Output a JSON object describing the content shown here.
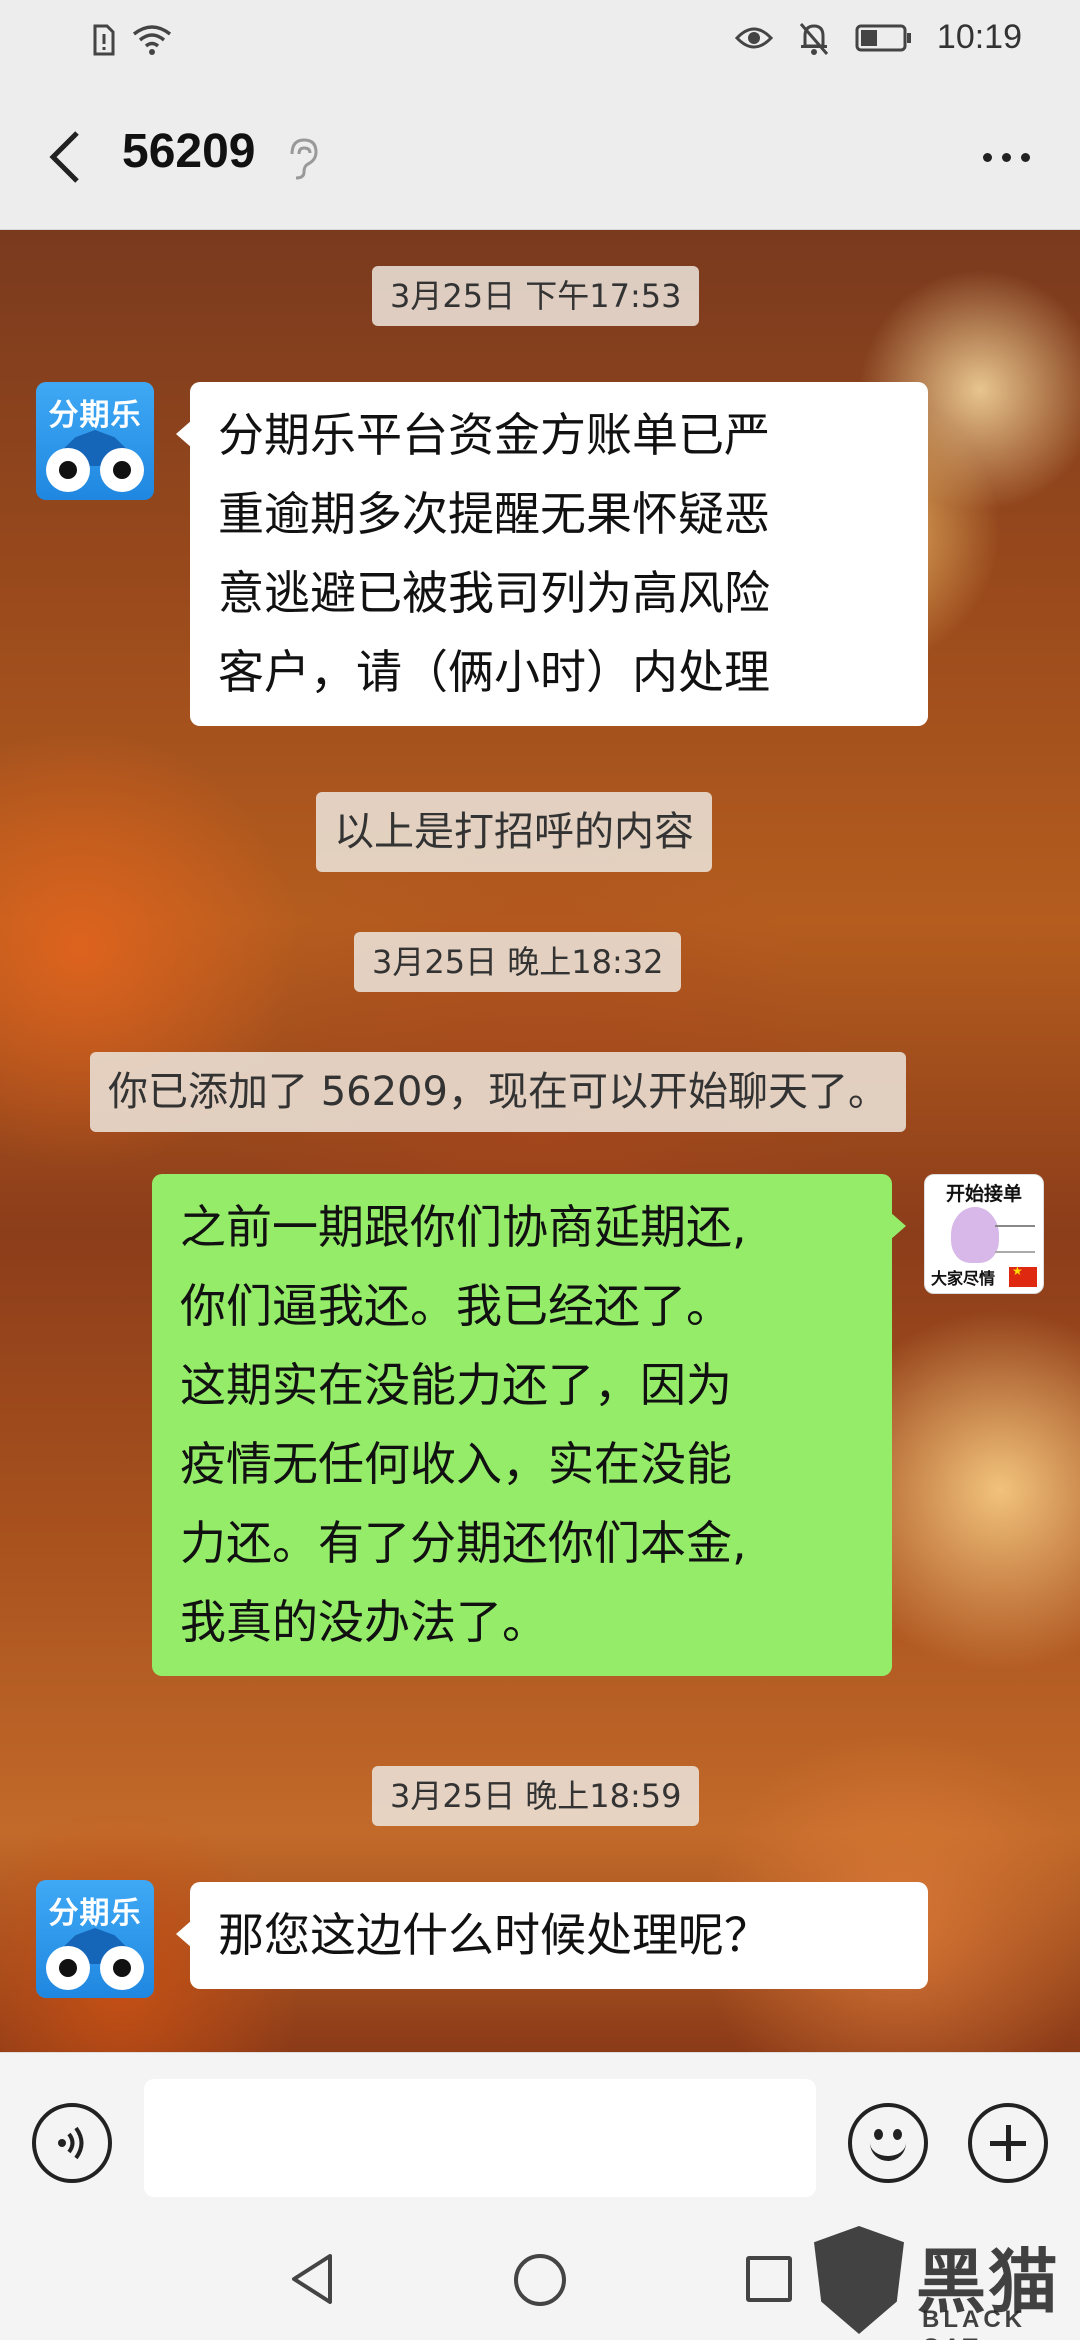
{
  "status_bar": {
    "time": "10:19"
  },
  "header": {
    "title": "56209"
  },
  "messages": {
    "ts1": "3月25日 下午17:53",
    "in1": {
      "avatar_text": "分期乐",
      "lines": [
        "分期乐平台资金方账单已严",
        "重逾期多次提醒无果怀疑恶",
        "意逃避已被我司列为高风险",
        "客户，请（俩小时）内处理"
      ]
    },
    "sys1": "以上是打招呼的内容",
    "ts2": "3月25日 晚上18:32",
    "sys2": "你已添加了 56209，现在可以开始聊天了。",
    "out1": {
      "avatar_top_text": "开始接单",
      "avatar_bottom_text": "大家尽情",
      "lines": [
        "之前一期跟你们协商延期还,",
        "你们逼我还。我已经还了。",
        "这期实在没能力还了，因为",
        "疫情无任何收入，实在没能",
        "力还。有了分期还你们本金,",
        "我真的没办法了。"
      ]
    },
    "ts3": "3月25日 晚上18:59",
    "in2": {
      "avatar_text": "分期乐",
      "lines": [
        "那您这边什么时候处理呢？"
      ]
    }
  },
  "input_bar": {
    "placeholder": ""
  },
  "watermark": {
    "cn": "黑猫",
    "en": "BLACK CAT"
  },
  "icons": [
    "sim-alert-icon",
    "wifi-icon",
    "eye-icon",
    "mute-icon",
    "battery-icon",
    "back-arrow-icon",
    "ear-icon",
    "more-icon",
    "voice-icon",
    "emoji-icon",
    "plus-icon",
    "nav-back-icon",
    "nav-home-icon",
    "nav-recent-icon"
  ]
}
